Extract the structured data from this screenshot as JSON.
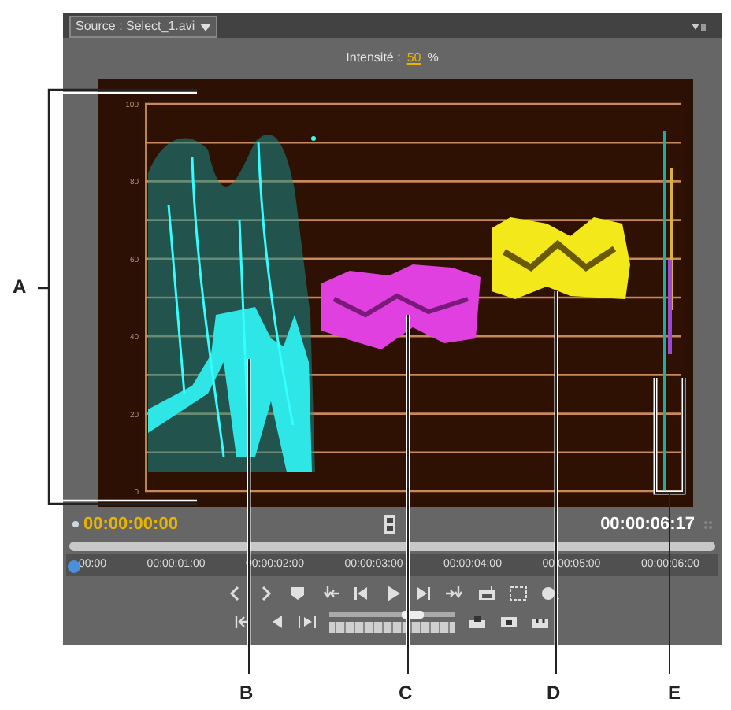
{
  "panel": {
    "tab": "Source : Select_1.avi"
  },
  "intensity": {
    "label": "Intensité :",
    "value": "50",
    "unit": "%"
  },
  "waveform": {
    "scale_labels": [
      "100",
      "80",
      "60",
      "40",
      "20",
      "0"
    ]
  },
  "timecodes": {
    "current": "00:00:00:00",
    "duration": "00:00:06:17"
  },
  "ruler": {
    "labels": [
      "00:00",
      "00:00:01:00",
      "00:00:02:00",
      "00:00:03:00",
      "00:00:04:00",
      "00:00:05:00",
      "00:00:06:00"
    ]
  },
  "callouts": [
    "A",
    "B",
    "C",
    "D",
    "E"
  ]
}
